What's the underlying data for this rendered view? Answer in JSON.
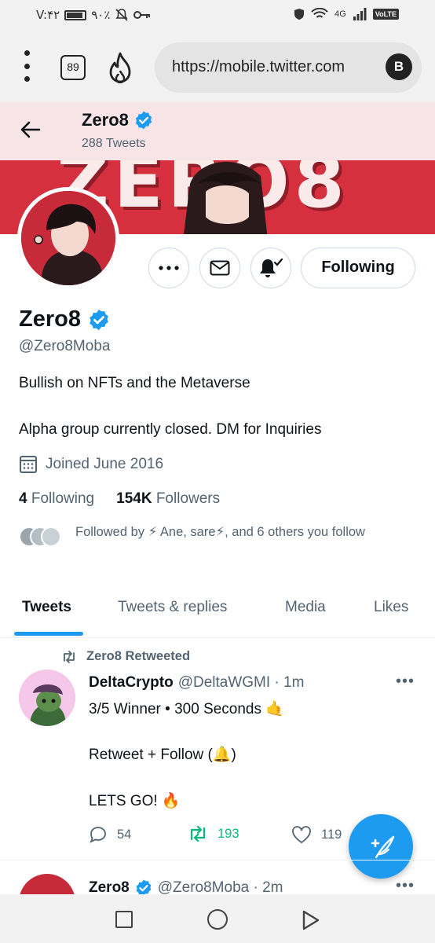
{
  "status_bar": {
    "time": "V:۴۲",
    "battery": "۹۰٪",
    "signal": "4G",
    "volte": "VoLTE"
  },
  "browser": {
    "tab_count": "89",
    "url": "https://mobile.twitter.com",
    "profile_initial": "B"
  },
  "header": {
    "name": "Zero8",
    "tweet_count": "288 Tweets"
  },
  "banner": {
    "text": "ZERO8"
  },
  "actions": {
    "follow_label": "Following"
  },
  "profile": {
    "name": "Zero8",
    "handle": "@Zero8Moba",
    "bio_line1": "Bullish on NFTs and the Metaverse",
    "bio_line2": "Alpha group currently closed. DM for Inquiries",
    "joined": "Joined June 2016",
    "following_count": "4",
    "following_label": "Following",
    "followers_count": "154K",
    "followers_label": "Followers",
    "followed_by": "Followed by ⚡ Ane, sare⚡, and 6 others you follow"
  },
  "tabs": [
    "Tweets",
    "Tweets & replies",
    "Media",
    "Likes"
  ],
  "tweet": {
    "retweeted_by": "Zero8 Retweeted",
    "author": "DeltaCrypto",
    "handle_time": "@DeltaWGMI · 1m",
    "more": "•••",
    "line1": "3/5 Winner • 300 Seconds 🤙",
    "line2": "Retweet + Follow (🔔)",
    "line3": "LETS GO! 🔥",
    "replies": "54",
    "retweets": "193",
    "likes": "119"
  },
  "next_tweet": {
    "author": "Zero8",
    "handle_time": "@Zero8Moba · 2m",
    "more": "•••"
  },
  "colors": {
    "accent": "#1d9bf0",
    "retweet_green": "#00ba7c",
    "banner_red": "#d6303f"
  }
}
